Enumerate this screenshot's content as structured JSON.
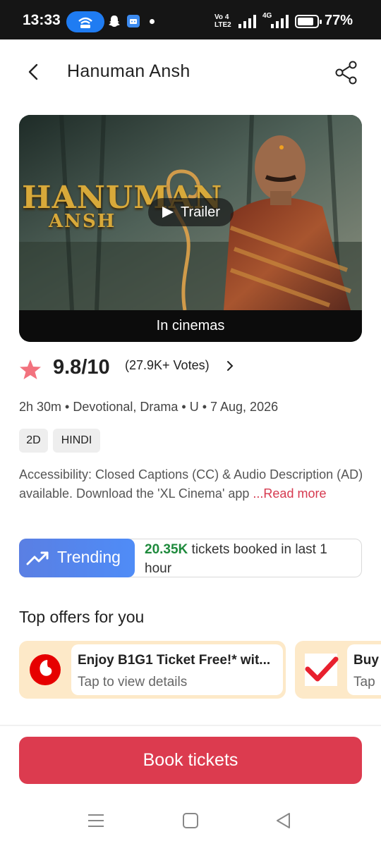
{
  "status_bar": {
    "time": "13:33",
    "volte_top": "Vo 4",
    "volte_bottom": "LTE2",
    "network": "4G",
    "battery": "77%"
  },
  "header": {
    "title": "Hanuman Ansh",
    "back_icon": "chevron-left-icon",
    "share_icon": "share-icon"
  },
  "poster": {
    "logo_line1": "HANUMAN",
    "logo_line2": "ANSH",
    "trailer_label": "Trailer",
    "strip_label": "In cinemas"
  },
  "rating": {
    "value": "9.8/10",
    "votes": "(27.9K+ Votes)",
    "color": "#f2727e"
  },
  "meta": "2h 30m • Devotional, Drama • U • 7 Aug, 2026",
  "tags": [
    "2D",
    "HINDI"
  ],
  "accessibility": {
    "text": "Accessibility: Closed Captions (CC) & Audio Description (AD) available. Download the 'XL Cinema' app ",
    "link": "...Read more"
  },
  "trending": {
    "label": "Trending",
    "count": "20.35K",
    "text": " tickets booked in last 1 hour"
  },
  "offers": {
    "title": "Top offers for you",
    "items": [
      {
        "title": "Enjoy B1G1 Ticket Free!* wit...",
        "subtitle": "Tap to view details"
      },
      {
        "title": "Buy",
        "subtitle": "Tap"
      }
    ]
  },
  "book_button": "Book tickets",
  "colors": {
    "brand": "#dc3b4f",
    "trending_green": "#1e8a3c",
    "trending_blue": "#4f8cf7",
    "offer_bg": "#fde9c8"
  }
}
